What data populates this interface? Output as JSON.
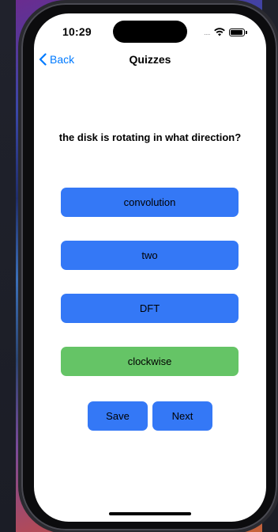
{
  "status_bar": {
    "time": "10:29",
    "signal_dots": "....",
    "wifi_icon": "wifi-icon",
    "battery_icon": "battery-icon"
  },
  "nav": {
    "back_label": "Back",
    "title": "Quizzes"
  },
  "quiz": {
    "question": "the disk is rotating in what direction?",
    "answers": [
      {
        "label": "convolution",
        "state": "default"
      },
      {
        "label": "two",
        "state": "default"
      },
      {
        "label": "DFT",
        "state": "default"
      },
      {
        "label": "clockwise",
        "state": "correct"
      }
    ]
  },
  "actions": {
    "save_label": "Save",
    "next_label": "Next"
  },
  "colors": {
    "accent": "#3478f6",
    "correct": "#65c466",
    "link": "#007aff"
  }
}
